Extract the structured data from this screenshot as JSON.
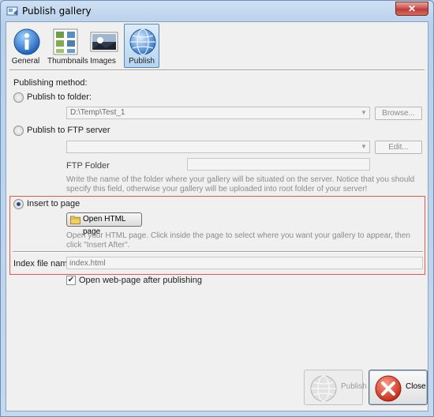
{
  "window": {
    "title": "Publish gallery",
    "title_icon": "publish-gallery-icon",
    "close_icon": "close-x-icon"
  },
  "toolbar": {
    "items": [
      {
        "label": "General",
        "icon": "info-icon"
      },
      {
        "label": "Thumbnails",
        "icon": "thumbnails-icon"
      },
      {
        "label": "Images",
        "icon": "image-icon"
      },
      {
        "label": "Publish",
        "icon": "globe-icon",
        "selected": true
      }
    ]
  },
  "publishing": {
    "method_label": "Publishing method:",
    "folder": {
      "label": "Publish to folder:",
      "value": "D:\\Temp\\Test_1",
      "button": "Browse..."
    },
    "ftp": {
      "label": "Publish to FTP server",
      "value": "",
      "button": "Edit...",
      "folder_label": "FTP Folder",
      "folder_value": "",
      "hint": "Write the name of the folder where your gallery will be situated on the server. Notice that you should specify this field, otherwise your gallery will be uploaded into root folder of your server!"
    },
    "insert": {
      "label": "Insert to page",
      "selected": true,
      "button": "Open HTML page",
      "button_icon": "folder-icon",
      "hint": "Open your HTML page. Click inside the page to select where you want your gallery to appear, then click \"Insert After\".",
      "index_label": "Index file name",
      "index_placeholder": "index.html"
    },
    "open_after": {
      "label": "Open web-page after publishing",
      "checked": true
    }
  },
  "footer": {
    "publish_label": "Publish",
    "close_label": "Close"
  },
  "colors": {
    "highlight": "#e25b4b",
    "accent": "#2b4d7a",
    "close_red": "#d8412f"
  }
}
